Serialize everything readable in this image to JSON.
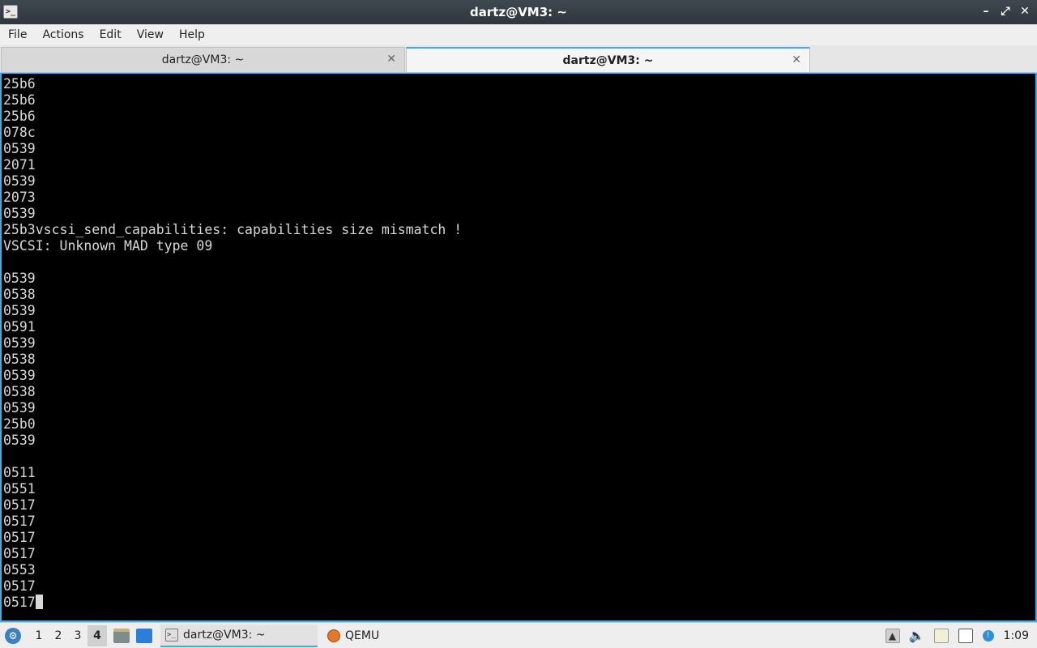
{
  "window": {
    "title": "dartz@VM3: ~",
    "app_icon": ">_",
    "minimize": "–",
    "maximize": "⤢",
    "close": "✕"
  },
  "menu": {
    "file": "File",
    "actions": "Actions",
    "edit": "Edit",
    "view": "View",
    "help": "Help"
  },
  "tabs": [
    {
      "label": "dartz@VM3: ~",
      "close": "✕",
      "active": false
    },
    {
      "label": "dartz@VM3: ~",
      "close": "✕",
      "active": true
    }
  ],
  "terminal": {
    "lines": [
      "25b6",
      "25b6",
      "25b6",
      "078c",
      "0539",
      "2071",
      "0539",
      "2073",
      "0539",
      "25b3vscsi_send_capabilities: capabilities size mismatch !",
      "VSCSI: Unknown MAD type 09",
      "",
      "0539",
      "0538",
      "0539",
      "0591",
      "0539",
      "0538",
      "0539",
      "0538",
      "0539",
      "25b0",
      "0539",
      "",
      "0511",
      "0551",
      "0517",
      "0517",
      "0517",
      "0517",
      "0553",
      "0517",
      "0517"
    ],
    "colors": {
      "background": "#000000",
      "foreground": "#d8d8d8",
      "accent": "#3daee9"
    }
  },
  "taskbar": {
    "start_icon": "start-menu-icon",
    "desktops": [
      "1",
      "2",
      "3",
      "4"
    ],
    "current_desktop": "4",
    "tasks": [
      {
        "label": "dartz@VM3: ~",
        "icon": "terminal-icon"
      },
      {
        "label": "QEMU",
        "icon": "qemu-icon"
      }
    ],
    "tray": {
      "volume_glyph": "🔈",
      "update_glyph": "!"
    },
    "clock": "1:09"
  }
}
